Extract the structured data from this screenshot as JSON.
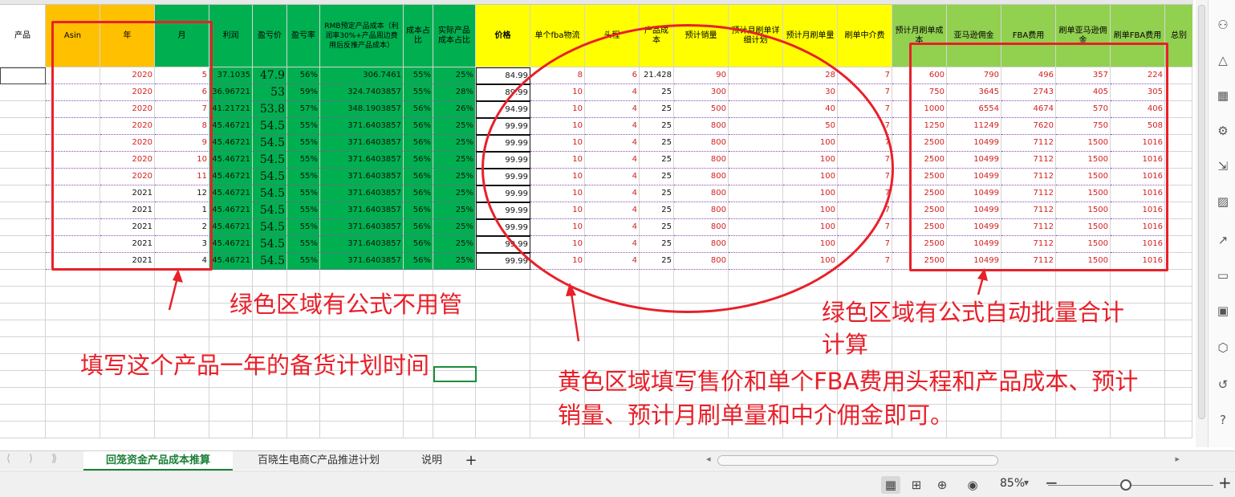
{
  "sheet": {
    "header": {
      "product": "产品",
      "asin": "Asin",
      "year": "年",
      "month": "月",
      "profit": "利润",
      "breakeven_price": "盈亏价",
      "breakeven_rate": "盈亏率",
      "rmb_cost": "RMB预定产品成本（利润率30%+产品周边费用后反推产品成本）",
      "cost_ratio": "成本占比",
      "actual_cost_ratio": "实际产品成本占比",
      "price": "价格",
      "fba_shipping": "单个fba物流",
      "first_leg": "头程",
      "product_cost": "产品成本",
      "est_sales": "预计销量",
      "monthly_brush_plan": "预计月刷单详细计划",
      "monthly_brush_qty": "预计月刷单量",
      "brush_agent_fee": "刷单中介费",
      "monthly_brush_cost": "预计月刷单成本",
      "amazon_commission": "亚马逊佣金",
      "fba_fee": "FBA费用",
      "brush_amazon_commission": "刷单亚马逊佣金",
      "brush_fba_fee": "刷单FBA费用",
      "total": "总别"
    },
    "rows": [
      {
        "year": "2020",
        "month": "5",
        "profit": "37.1035",
        "bep": "47.9",
        "ber": "56%",
        "rmb": "306.7461",
        "cr": "55%",
        "acr": "25%",
        "price": "84.99",
        "fba": "8",
        "fl": "6",
        "pc": "21.428",
        "sales": "90",
        "plan": "",
        "bq": "28",
        "agent": "7",
        "bc": "600",
        "comm": "790",
        "fbaf": "496",
        "bcomm": "357",
        "bfba": "224"
      },
      {
        "year": "2020",
        "month": "6",
        "profit": "36.96721",
        "bep": "53",
        "ber": "59%",
        "rmb": "324.7403857",
        "cr": "55%",
        "acr": "28%",
        "price": "89.99",
        "fba": "10",
        "fl": "4",
        "pc": "25",
        "sales": "300",
        "plan": "",
        "bq": "30",
        "agent": "7",
        "bc": "750",
        "comm": "3645",
        "fbaf": "2743",
        "bcomm": "405",
        "bfba": "305"
      },
      {
        "year": "2020",
        "month": "7",
        "profit": "41.21721",
        "bep": "53.8",
        "ber": "57%",
        "rmb": "348.1903857",
        "cr": "56%",
        "acr": "26%",
        "price": "94.99",
        "fba": "10",
        "fl": "4",
        "pc": "25",
        "sales": "500",
        "plan": "",
        "bq": "40",
        "agent": "7",
        "bc": "1000",
        "comm": "6554",
        "fbaf": "4674",
        "bcomm": "570",
        "bfba": "406"
      },
      {
        "year": "2020",
        "month": "8",
        "profit": "45.46721",
        "bep": "54.5",
        "ber": "55%",
        "rmb": "371.6403857",
        "cr": "56%",
        "acr": "25%",
        "price": "99.99",
        "fba": "10",
        "fl": "4",
        "pc": "25",
        "sales": "800",
        "plan": "",
        "bq": "50",
        "agent": "7",
        "bc": "1250",
        "comm": "11249",
        "fbaf": "7620",
        "bcomm": "750",
        "bfba": "508"
      },
      {
        "year": "2020",
        "month": "9",
        "profit": "45.46721",
        "bep": "54.5",
        "ber": "55%",
        "rmb": "371.6403857",
        "cr": "56%",
        "acr": "25%",
        "price": "99.99",
        "fba": "10",
        "fl": "4",
        "pc": "25",
        "sales": "800",
        "plan": "",
        "bq": "100",
        "agent": "7",
        "bc": "2500",
        "comm": "10499",
        "fbaf": "7112",
        "bcomm": "1500",
        "bfba": "1016"
      },
      {
        "year": "2020",
        "month": "10",
        "profit": "45.46721",
        "bep": "54.5",
        "ber": "55%",
        "rmb": "371.6403857",
        "cr": "56%",
        "acr": "25%",
        "price": "99.99",
        "fba": "10",
        "fl": "4",
        "pc": "25",
        "sales": "800",
        "plan": "",
        "bq": "100",
        "agent": "7",
        "bc": "2500",
        "comm": "10499",
        "fbaf": "7112",
        "bcomm": "1500",
        "bfba": "1016"
      },
      {
        "year": "2020",
        "month": "11",
        "profit": "45.46721",
        "bep": "54.5",
        "ber": "55%",
        "rmb": "371.6403857",
        "cr": "56%",
        "acr": "25%",
        "price": "99.99",
        "fba": "10",
        "fl": "4",
        "pc": "25",
        "sales": "800",
        "plan": "",
        "bq": "100",
        "agent": "7",
        "bc": "2500",
        "comm": "10499",
        "fbaf": "7112",
        "bcomm": "1500",
        "bfba": "1016"
      },
      {
        "year": "2021",
        "month": "12",
        "profit": "45.46721",
        "bep": "54.5",
        "ber": "55%",
        "rmb": "371.6403857",
        "cr": "56%",
        "acr": "25%",
        "price": "99.99",
        "fba": "10",
        "fl": "4",
        "pc": "25",
        "sales": "800",
        "plan": "",
        "bq": "100",
        "agent": "7",
        "bc": "2500",
        "comm": "10499",
        "fbaf": "7112",
        "bcomm": "1500",
        "bfba": "1016"
      },
      {
        "year": "2021",
        "month": "1",
        "profit": "45.46721",
        "bep": "54.5",
        "ber": "55%",
        "rmb": "371.6403857",
        "cr": "56%",
        "acr": "25%",
        "price": "99.99",
        "fba": "10",
        "fl": "4",
        "pc": "25",
        "sales": "800",
        "plan": "",
        "bq": "100",
        "agent": "7",
        "bc": "2500",
        "comm": "10499",
        "fbaf": "7112",
        "bcomm": "1500",
        "bfba": "1016"
      },
      {
        "year": "2021",
        "month": "2",
        "profit": "45.46721",
        "bep": "54.5",
        "ber": "55%",
        "rmb": "371.6403857",
        "cr": "56%",
        "acr": "25%",
        "price": "99.99",
        "fba": "10",
        "fl": "4",
        "pc": "25",
        "sales": "800",
        "plan": "",
        "bq": "100",
        "agent": "7",
        "bc": "2500",
        "comm": "10499",
        "fbaf": "7112",
        "bcomm": "1500",
        "bfba": "1016"
      },
      {
        "year": "2021",
        "month": "3",
        "profit": "45.46721",
        "bep": "54.5",
        "ber": "55%",
        "rmb": "371.6403857",
        "cr": "56%",
        "acr": "25%",
        "price": "99.99",
        "fba": "10",
        "fl": "4",
        "pc": "25",
        "sales": "800",
        "plan": "",
        "bq": "100",
        "agent": "7",
        "bc": "2500",
        "comm": "10499",
        "fbaf": "7112",
        "bcomm": "1500",
        "bfba": "1016"
      },
      {
        "year": "2021",
        "month": "4",
        "profit": "45.46721",
        "bep": "54.5",
        "ber": "55%",
        "rmb": "371.6403857",
        "cr": "56%",
        "acr": "25%",
        "price": "99.99",
        "fba": "10",
        "fl": "4",
        "pc": "25",
        "sales": "800",
        "plan": "",
        "bq": "100",
        "agent": "7",
        "bc": "2500",
        "comm": "10499",
        "fbaf": "7112",
        "bcomm": "1500",
        "bfba": "1016"
      }
    ]
  },
  "annotations": {
    "green_no_care": "绿色区域有公式不用管",
    "fill_plan": "填写这个产品一年的备货计划时间",
    "yellow_fill_line1": "黄色区域填写售价和单个FBA费用头程和产品成本、预计",
    "yellow_fill_line2": "销量、预计月刷单量和中介佣金即可。",
    "green_auto_line1": "绿色区域有公式自动批量合计",
    "green_auto_line2": "计算"
  },
  "tabs": {
    "sheet1": "回笼资金产品成本推算",
    "sheet2": "百晓生电商C产品推进计划",
    "sheet3": "说明",
    "add": "+"
  },
  "status": {
    "zoom": "85%",
    "zoom_minus": "−",
    "zoom_plus": "+"
  },
  "colors": {
    "orange": "#ffc000",
    "green": "#00b050",
    "yellow": "#ffff00",
    "light_green": "#92d050",
    "annotation_red": "#e8202a"
  }
}
